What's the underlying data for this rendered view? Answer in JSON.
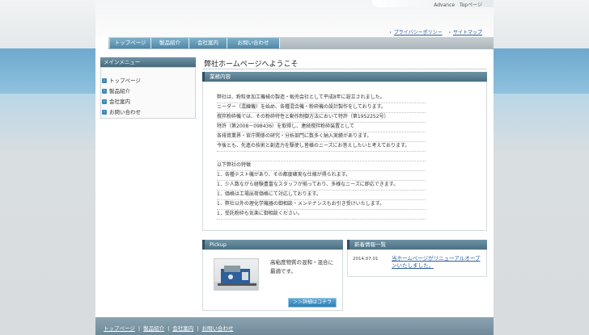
{
  "top_links": [
    "Advance",
    "Topページ"
  ],
  "util_links": [
    {
      "label": "プライバシーポリシー"
    },
    {
      "label": "サイトマップ"
    }
  ],
  "nav": [
    "トップページ",
    "製品紹介",
    "会社案内",
    "お問い合わせ"
  ],
  "sidebar": {
    "title": "メインメニュー",
    "items": [
      "トップページ",
      "製品紹介",
      "会社案内",
      "お問い合わせ"
    ]
  },
  "main": {
    "welcome": "弊社ホームページへようこそ",
    "section_title": "業務内容",
    "lines": [
      "弊社は、粉粒体加工機械の製造・販売会社として平成8年に設立されました。",
      "ニーダー（混練機）を始め、各種混合機・粉砕機の設計製作をしております。",
      "撹拌粉砕機では、その粉砕特性と動作制御方法において特許（第1952252号）",
      "特許（第2008－098436）を取得し、連続撹拌粉砕装置として",
      "各排資業界・官庁関係の研究・分析部門に数多く納入実績があります。",
      "今後とも、先進の技術と創造力を駆使し皆様のニーズにお答えしたいと考えております。",
      "",
      "以下弊社の特徴",
      "1．各種テスト機があり、その都度確実な仕様が得られます。",
      "1．少人数ながら経験豊富なスタッフが揃っており、多様なニーズに即応できます。",
      "1．価格は工場出荷価格にて対応しております。",
      "1．弊社以外の理化学機器の御相談・メンテナンスもお引き受けいたします。",
      "1．受託粉砕も気楽に御相談ください。"
    ]
  },
  "pickup": {
    "title": "Pickup",
    "text": "高粘度物質の混和・混合に最適です。",
    "button": "＞＞詳細はコチラ"
  },
  "news": {
    "title": "新着情報一覧",
    "items": [
      {
        "date": "2014.07.01",
        "text": "当ホームページがリニューアルオープンいたしました。"
      }
    ]
  },
  "footer": [
    "トップページ",
    "製品紹介",
    "会社案内",
    "お問い合わせ"
  ]
}
